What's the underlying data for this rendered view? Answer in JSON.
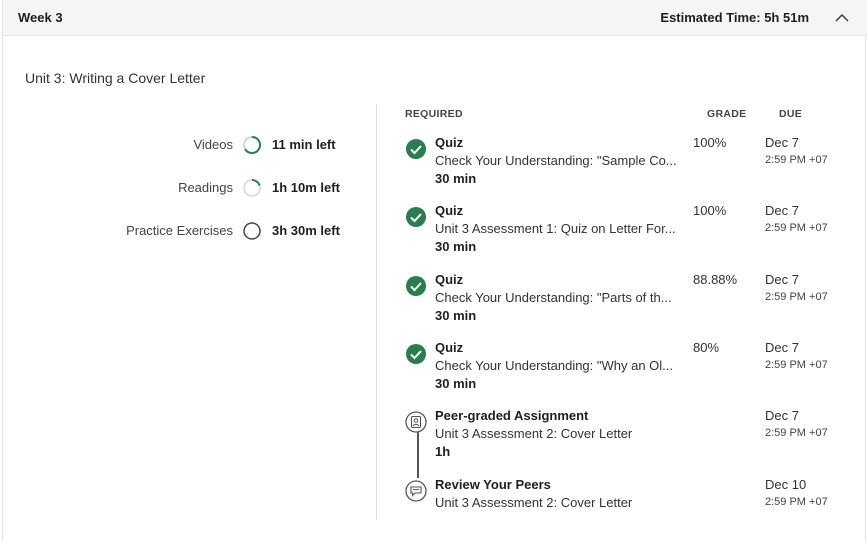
{
  "header": {
    "week_title": "Week 3",
    "estimated_time": "Estimated Time: 5h 51m",
    "collapse_icon": "chevron-up-icon"
  },
  "unit": {
    "title": "Unit 3: Writing a Cover Letter"
  },
  "summary": [
    {
      "label": "Videos",
      "value": "11 min left",
      "progress": 0.6,
      "icon": "progress-ring-icon"
    },
    {
      "label": "Readings",
      "value": "1h 10m left",
      "progress": 0.2,
      "icon": "progress-ring-icon"
    },
    {
      "label": "Practice Exercises",
      "value": "3h 30m left",
      "progress": 0.0,
      "icon": "progress-ring-icon"
    }
  ],
  "columns": {
    "required": "REQUIRED",
    "grade": "GRADE",
    "due": "DUE"
  },
  "items": [
    {
      "type": "Quiz",
      "name": "Check Your Understanding: \"Sample Co...",
      "duration": "30 min",
      "grade": "100%",
      "due_date": "Dec 7",
      "due_time": "2:59 PM +07",
      "status": "completed",
      "icon": "check-circle-icon"
    },
    {
      "type": "Quiz",
      "name": "Unit 3 Assessment 1: Quiz on Letter For...",
      "duration": "30 min",
      "grade": "100%",
      "due_date": "Dec 7",
      "due_time": "2:59 PM +07",
      "status": "completed",
      "icon": "check-circle-icon"
    },
    {
      "type": "Quiz",
      "name": "Check Your Understanding: \"Parts of th...",
      "duration": "30 min",
      "grade": "88.88%",
      "due_date": "Dec 7",
      "due_time": "2:59 PM +07",
      "status": "completed",
      "icon": "check-circle-icon"
    },
    {
      "type": "Quiz",
      "name": "Check Your Understanding: \"Why an Ol...",
      "duration": "30 min",
      "grade": "80%",
      "due_date": "Dec 7",
      "due_time": "2:59 PM +07",
      "status": "completed",
      "icon": "check-circle-icon"
    },
    {
      "type": "Peer-graded Assignment",
      "name": "Unit 3 Assessment 2: Cover Letter",
      "duration": "1h",
      "grade": "",
      "due_date": "Dec 7",
      "due_time": "2:59 PM +07",
      "status": "pending",
      "icon": "peer-assignment-icon"
    },
    {
      "type": "Review Your Peers",
      "name": "Unit 3 Assessment 2: Cover Letter",
      "duration": "",
      "grade": "",
      "due_date": "Dec 10",
      "due_time": "2:59 PM +07",
      "status": "pending",
      "icon": "peer-review-icon"
    }
  ],
  "colors": {
    "accent_green": "#2a7d4f",
    "ring_grey": "#c8c8c8",
    "header_bg": "#f5f5f5"
  }
}
